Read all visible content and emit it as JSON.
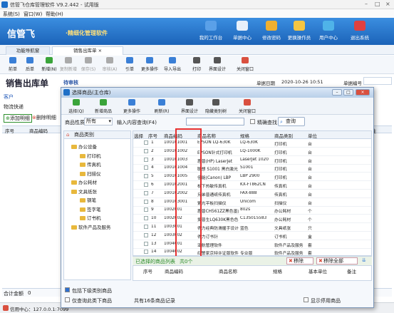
{
  "window": {
    "title": "信管飞仓库管理软件 V9.2.442 - 试用版"
  },
  "menu": [
    "系统(S)",
    "窗口(W)",
    "帮助(H)"
  ],
  "banner": {
    "logo": "信管飞",
    "slogan": "·精细化管理软件",
    "items": [
      {
        "label": "我的工作台",
        "color": "#5aa0e8"
      },
      {
        "label": "单据中心",
        "color": "#e8f0fa"
      },
      {
        "label": "修改密码",
        "color": "#f0b030"
      },
      {
        "label": "更换操作员",
        "color": "#f5c542"
      },
      {
        "label": "用户中心",
        "color": "#4fb3e8"
      },
      {
        "label": "退出系统",
        "color": "#e04040"
      }
    ]
  },
  "tabs": [
    "功能导航窗",
    "销售出库单"
  ],
  "toolbar": [
    {
      "label": "前单",
      "color": "#3a7fd6"
    },
    {
      "label": "后单",
      "color": "#3a7fd6"
    },
    {
      "label": "新增(N)",
      "color": "#3aa43a"
    },
    {
      "label": "复制新增",
      "color": "#aaa",
      "disabled": true
    },
    {
      "label": "保存(S)",
      "color": "#aaa",
      "disabled": true
    },
    {
      "label": "审核(A)",
      "color": "#aaa",
      "disabled": true
    },
    {
      "label": "引单",
      "color": "#3a7fd6"
    },
    {
      "label": "更多操作",
      "color": "#3a7fd6"
    },
    {
      "label": "导入导出",
      "color": "#3a7fd6"
    },
    {
      "label": "打印",
      "color": "#555"
    },
    {
      "label": "界面设计",
      "color": "#555"
    },
    {
      "label": "关闭窗口",
      "color": "#d9503f"
    }
  ],
  "doc": {
    "title": "销售出库单",
    "status": "待审核",
    "date_label": "单据日期",
    "date": "2020-10-26 10:51",
    "no_label": "单据编号",
    "customer_label": "客户",
    "logistics_label": "物流快递",
    "add_detail": "添加明细",
    "del_detail": "删除明细",
    "grid_headers": [
      "序号",
      "商品编码",
      "备注"
    ],
    "total_label": "合计金额",
    "total_value": "0"
  },
  "statusbar": {
    "center": "信用中心：127.0.0.1:7099"
  },
  "dialog": {
    "title": "选择商品(主仓库)",
    "toolbar": [
      {
        "label": "选择(Q)",
        "color": "#3aa43a"
      },
      {
        "label": "新增商品",
        "color": "#3aa43a"
      },
      {
        "label": "更多操作",
        "color": "#3a7fd6"
      },
      {
        "label": "刷新(R)",
        "color": "#3a7fd6"
      },
      {
        "label": "界面设计",
        "color": "#555"
      },
      {
        "label": "隐藏类别树",
        "color": "#555"
      },
      {
        "label": "关闭窗口",
        "color": "#d9503f"
      }
    ],
    "filter": {
      "category_label": "商品性质",
      "category_value": "所有",
      "query_label": "输入内容查询(F4)",
      "exact_label": "精确查找",
      "search_label": "查询"
    },
    "tree": {
      "header": "商品类别",
      "nodes": [
        {
          "label": "办公设备",
          "level": 1
        },
        {
          "label": "打印机",
          "level": 2
        },
        {
          "label": "传真机",
          "level": 2
        },
        {
          "label": "扫描仪",
          "level": 2
        },
        {
          "label": "办公耗材",
          "level": 1
        },
        {
          "label": "文具纸张",
          "level": 1
        },
        {
          "label": "钢笔",
          "level": 2
        },
        {
          "label": "签字笔",
          "level": 2
        },
        {
          "label": "订书机",
          "level": 2
        },
        {
          "label": "软件产品及服务",
          "level": 1
        }
      ]
    },
    "grid": {
      "headers": [
        "选择",
        "序号",
        "商品编码",
        "商品名称",
        "规格",
        "商品类别",
        "单位"
      ],
      "rows": [
        [
          "1",
          "100101001",
          "EPSON LQ-630K",
          "LQ-630K",
          "打印机",
          "台"
        ],
        [
          "2",
          "100101002",
          "EPSON针式打印机",
          "LQ-1000K",
          "打印机",
          "台"
        ],
        [
          "3",
          "100101003",
          "惠普(HP) LaserJet",
          "LaserJet 1020",
          "打印机",
          "台"
        ],
        [
          "4",
          "100101004",
          "联想 S1001 黑白激光",
          "S1001",
          "打印机",
          "台"
        ],
        [
          "5",
          "100101005",
          "佳能(Canon) LBP",
          "LBP 2900",
          "打印机",
          "台"
        ],
        [
          "6",
          "100102001",
          "松下热敏传真机",
          "KX-FT862CN",
          "传真机",
          "台"
        ],
        [
          "7",
          "100102002",
          "兄弟普通纸传真机",
          "FAX-888",
          "传真机",
          "台"
        ],
        [
          "8",
          "100103001",
          "紫光平板扫描仪",
          "Unicom",
          "扫描仪",
          "台"
        ],
        [
          "9",
          "1002001",
          "惠普CH561ZZ黑色墨盒",
          "802s",
          "办公耗材",
          "个"
        ],
        [
          "10",
          "1002002",
          "爱普生LQ630K黑色色",
          "C13S015583",
          "办公耗材",
          "个"
        ],
        [
          "11",
          "1003001",
          "得力经典防滑握手设计",
          "蓝色",
          "文具纸张",
          "只"
        ],
        [
          "12",
          "1003002",
          "得力订书针",
          "",
          "订书机",
          "盒"
        ],
        [
          "13",
          "1004001",
          "亚航管理软件",
          "",
          "软件产品及服务",
          "套"
        ],
        [
          "14",
          "1004002",
          "红警家京特许证版软件",
          "专业版",
          "软件产品及服务",
          "套"
        ]
      ]
    },
    "selected": {
      "label": "已选择的商品列表",
      "count": "共0个",
      "remove": "移除",
      "remove_all": "移除全部",
      "headers": [
        "序号",
        "商品编码",
        "商品名称",
        "规格",
        "基本单位",
        "备注"
      ]
    },
    "bottom": {
      "include_sub": "包括下级类别商品",
      "only_sub": "仅查询此类下商品",
      "total": "共有16条商品记录",
      "show_disabled": "显示停用商品"
    }
  }
}
